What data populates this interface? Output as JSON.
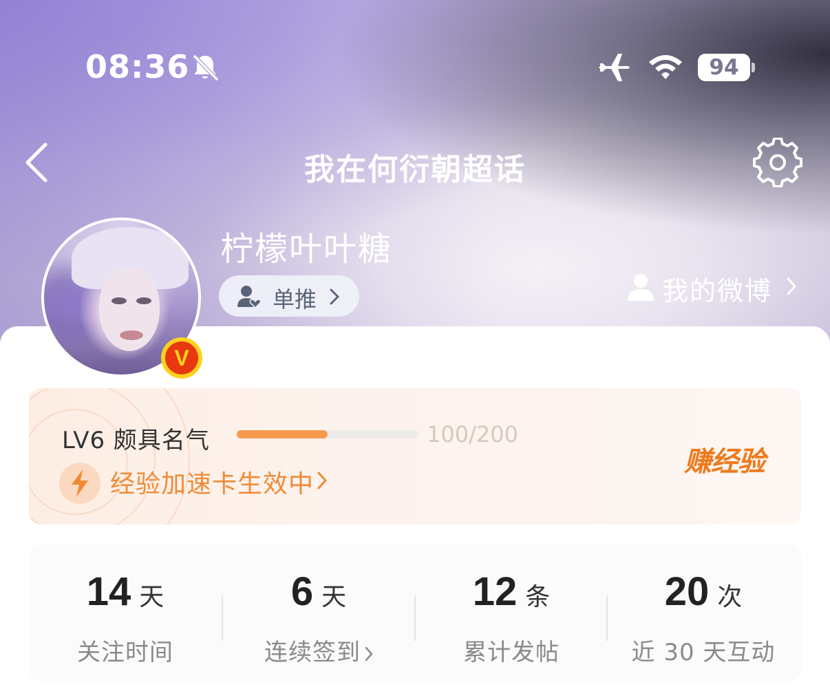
{
  "status_bar": {
    "time": "08:36",
    "battery": "94",
    "icons": [
      "bell-slash-icon",
      "airplane-icon",
      "wifi-icon",
      "battery-icon"
    ]
  },
  "nav": {
    "title": "我在何衍朝超话",
    "icons": [
      "back-icon",
      "settings-icon"
    ]
  },
  "profile": {
    "username": "柠檬叶叶糖",
    "badge": "V",
    "fan_tag": "单推",
    "my_weibo": "我的微博"
  },
  "level": {
    "label": "LV6 颇具名气",
    "progress_text": "100/200",
    "progress_fraction": 0.5,
    "boost_label": "经验加速卡生效中",
    "earn_label": "赚经验"
  },
  "stats": [
    {
      "value": "14",
      "unit": "天",
      "label": "关注时间"
    },
    {
      "value": "6",
      "unit": "天",
      "label": "连续签到"
    },
    {
      "value": "12",
      "unit": "条",
      "label": "累计发帖"
    },
    {
      "value": "20",
      "unit": "次",
      "label": "近 30 天互动"
    }
  ],
  "colors": {
    "accent_orange": "#f08a36",
    "progress_fill": "#f79a4e",
    "badge_red": "#e8380f",
    "badge_yellow": "#ffd21f"
  }
}
